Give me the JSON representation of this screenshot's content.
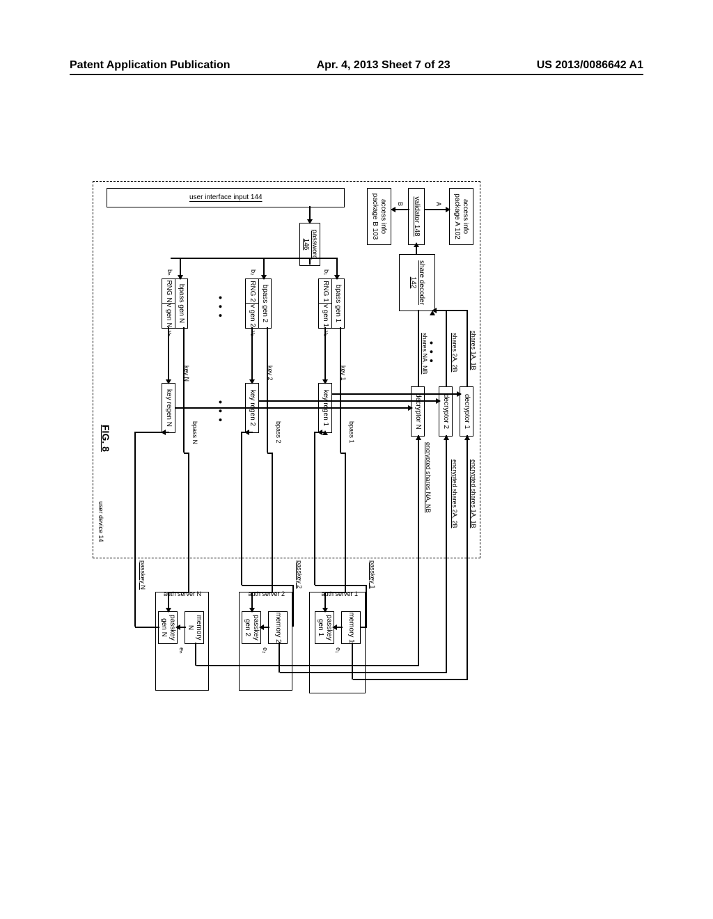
{
  "header": {
    "left": "Patent Application Publication",
    "center": "Apr. 4, 2013  Sheet 7 of 23",
    "right": "US 2013/0086642 A1"
  },
  "figure_label": "FIG. 8",
  "user_device": {
    "label": "user device 14",
    "ui_input": "user interface input 144",
    "password": "password 146",
    "access_a": "access info package A 102",
    "access_b": "access info package B 103",
    "validator": "validator 148",
    "share_decoder": "share decoder 142"
  },
  "bpass": [
    {
      "box": "bpass gen 1",
      "rng": "RNG 1",
      "vgen": "v gen 1",
      "b": "b₁",
      "v": "v₁",
      "label_bpass": "bpass 1",
      "key_label": "key 1",
      "key_regen": "key regen 1"
    },
    {
      "box": "bpass gen 2",
      "rng": "RNG 2",
      "vgen": "v gen 2",
      "b": "b₂",
      "v": "v₂",
      "label_bpass": "bpass 2",
      "key_label": "key 2",
      "key_regen": "key regen 2"
    },
    {
      "box": "bpass gen N",
      "rng": "RNG N",
      "vgen": "v gen N",
      "b": "bₙ",
      "v": "vₙ",
      "label_bpass": "bpass N",
      "key_label": "key N",
      "key_regen": "key regen N"
    }
  ],
  "decryptors": [
    {
      "box": "decryptor 1",
      "shares_out": "shares 1A, 1B",
      "shares_in": "encrypted shares 1A, 1B"
    },
    {
      "box": "decryptor 2",
      "shares_out": "shares 2A, 2B",
      "shares_in": "encrypted shares 2A, 2B"
    },
    {
      "box": "decryptor N",
      "shares_out": "shares NA, NB",
      "shares_in": "encrypted shares NA, NB"
    }
  ],
  "auth_servers": [
    {
      "label": "auth server 1",
      "memory": "memory 1",
      "passkey_gen": "passkey gen 1",
      "e": "e₁",
      "passkey": "passkey 1"
    },
    {
      "label": "auth server 2",
      "memory": "memory 2",
      "passkey_gen": "passkey gen 2",
      "e": "e₂",
      "passkey": "passkey 2"
    },
    {
      "label": "auth server N",
      "memory": "memory N",
      "passkey_gen": "passkey gen N",
      "e": "eₙ",
      "passkey": "passkey N"
    }
  ],
  "ab_labels": {
    "a": "A",
    "b": "B"
  },
  "ellipsis": "• • •"
}
